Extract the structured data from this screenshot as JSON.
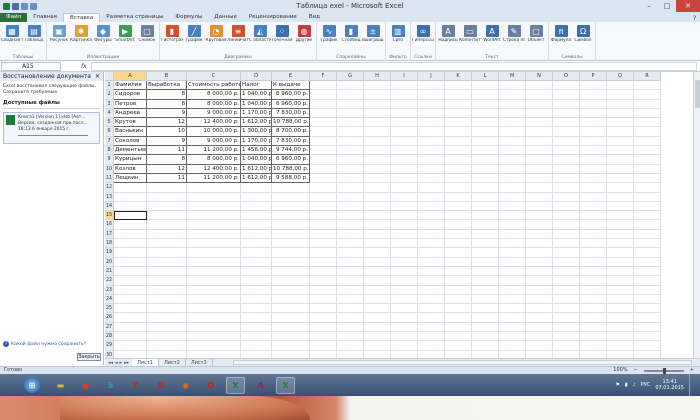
{
  "window": {
    "title": "Таблица exel  -  Microsoft Excel",
    "min": "–",
    "max": "□",
    "close": "✕"
  },
  "tabs": [
    "Файл",
    "Главная",
    "Вставка",
    "Разметка страницы",
    "Формулы",
    "Данные",
    "Рецензирование",
    "Вид"
  ],
  "active_tab": "Вставка",
  "ribbon_groups": [
    {
      "label": "Таблицы",
      "buttons": [
        {
          "label": "Сводная таблица",
          "icon": "pivot-table-icon",
          "color": "#4a7fc1",
          "glyph": "▦"
        },
        {
          "label": "Таблица",
          "icon": "table-icon",
          "color": "#4a7fc1",
          "glyph": "▤"
        }
      ]
    },
    {
      "label": "Иллюстрации",
      "buttons": [
        {
          "label": "Рисунок",
          "icon": "picture-icon",
          "color": "#6aa0d0",
          "glyph": "▣"
        },
        {
          "label": "Картинка",
          "icon": "clipart-icon",
          "color": "#e0a030",
          "glyph": "✱"
        },
        {
          "label": "Фигуры",
          "icon": "shapes-icon",
          "color": "#5a8fd0",
          "glyph": "◆"
        },
        {
          "label": "SmartArt",
          "icon": "smartart-icon",
          "color": "#3e9a50",
          "glyph": "▶"
        },
        {
          "label": "Снимок",
          "icon": "screenshot-icon",
          "color": "#6a7fa0",
          "glyph": "▢"
        }
      ]
    },
    {
      "label": "Диаграммы",
      "buttons": [
        {
          "label": "Гистограмма",
          "icon": "column-chart-icon",
          "color": "#d05030",
          "glyph": "▮"
        },
        {
          "label": "График",
          "icon": "line-chart-icon",
          "color": "#4a7fc1",
          "glyph": "╱"
        },
        {
          "label": "Круговая",
          "icon": "pie-chart-icon",
          "color": "#e09030",
          "glyph": "◔"
        },
        {
          "label": "Линейчатая",
          "icon": "bar-chart-icon",
          "color": "#d05030",
          "glyph": "≡"
        },
        {
          "label": "С областями",
          "icon": "area-chart-icon",
          "color": "#4a7fc1",
          "glyph": "◭"
        },
        {
          "label": "Точечная",
          "icon": "scatter-chart-icon",
          "color": "#3e6fb0",
          "glyph": "⁘"
        },
        {
          "label": "Другие",
          "icon": "other-charts-icon",
          "color": "#c04040",
          "glyph": "◍"
        }
      ]
    },
    {
      "label": "Спарклайны",
      "buttons": [
        {
          "label": "График",
          "icon": "sparkline-line-icon",
          "color": "#4a7fc1",
          "glyph": "∿"
        },
        {
          "label": "Столбец",
          "icon": "sparkline-column-icon",
          "color": "#4a7fc1",
          "glyph": "▮"
        },
        {
          "label": "Выигрыш / проигрыш",
          "icon": "sparkline-winloss-icon",
          "color": "#4a7fc1",
          "glyph": "±"
        }
      ]
    },
    {
      "label": "Фильтр",
      "buttons": [
        {
          "label": "Срез",
          "icon": "slicer-icon",
          "color": "#4a7fc1",
          "glyph": "▥"
        }
      ]
    },
    {
      "label": "Ссылки",
      "buttons": [
        {
          "label": "Гиперссылка",
          "icon": "hyperlink-icon",
          "color": "#3e6fb0",
          "glyph": "∞"
        }
      ]
    },
    {
      "label": "Текст",
      "buttons": [
        {
          "label": "Надпись",
          "icon": "textbox-icon",
          "color": "#6a7fa0",
          "glyph": "A"
        },
        {
          "label": "Колонтитулы",
          "icon": "header-footer-icon",
          "color": "#6a7fa0",
          "glyph": "▭"
        },
        {
          "label": "WordArt",
          "icon": "wordart-icon",
          "color": "#3e6fb0",
          "glyph": "A"
        },
        {
          "label": "Строка подписи",
          "icon": "signature-line-icon",
          "color": "#6a7fa0",
          "glyph": "✎"
        },
        {
          "label": "Объект",
          "icon": "object-icon",
          "color": "#6a7fa0",
          "glyph": "▢"
        }
      ]
    },
    {
      "label": "Символы",
      "buttons": [
        {
          "label": "Формула",
          "icon": "equation-icon",
          "color": "#3e6fb0",
          "glyph": "π"
        },
        {
          "label": "Символ",
          "icon": "symbol-icon",
          "color": "#3e6fb0",
          "glyph": "Ω"
        }
      ]
    }
  ],
  "formula_bar": {
    "namebox": "A15",
    "fx": "fx",
    "value": ""
  },
  "recovery": {
    "title": "Восстановление документа",
    "description": "Excel восстановил следующие файлы. Сохраните требуемые.",
    "available_label": "Доступные файлы",
    "file": {
      "line1": "Книга1 [Version 1].xlsb [Авт...",
      "line2": "Версия, созданная при посл...",
      "line3": "18:13 6 января 2015 г."
    },
    "help_link": "Какой файл нужно сохранить?",
    "close_button": "Закрыть"
  },
  "grid": {
    "columns": [
      "A",
      "B",
      "C",
      "D",
      "E",
      "F",
      "G",
      "H",
      "I",
      "J",
      "K",
      "L",
      "M",
      "N",
      "O",
      "P",
      "Q",
      "R"
    ],
    "header": [
      "Фамилия",
      "Выработка",
      "Стоимость работы",
      "Налог",
      "К выдаче"
    ],
    "rows": [
      [
        "Сидоров",
        "8",
        "8 000,00 р.",
        "1 040,00 р.",
        "6 960,00 р."
      ],
      [
        "Петров",
        "8",
        "8 000,00 р.",
        "1 040,00 р.",
        "6 960,00 р."
      ],
      [
        "Андреев",
        "9",
        "9 000,00 р.",
        "1 170,00 р.",
        "7 830,00 р."
      ],
      [
        "Крутов",
        "12",
        "12 400,00 р.",
        "1 612,00 р.",
        "10 788,00 р."
      ],
      [
        "Васнькин",
        "10",
        "10 000,00 р.",
        "1 300,00 р.",
        "8 700,00 р."
      ],
      [
        "Соколов",
        "9",
        "9 000,00 р.",
        "1 170,00 р.",
        "7 830,00 р."
      ],
      [
        "Дементьев",
        "11",
        "11 200,00 р.",
        "1 456,00 р.",
        "9 744,00 р."
      ],
      [
        "Курицын",
        "8",
        "8 000,00 р.",
        "1 040,00 р.",
        "6 960,00 р."
      ],
      [
        "Козлов",
        "12",
        "12 400,00 р.",
        "1 612,00 р.",
        "10 788,00 р."
      ],
      [
        "Лещкин",
        "11",
        "11 200,00 р.",
        "1 612,00 р.",
        "9 588,00 р."
      ]
    ],
    "row_count": 30,
    "active_row": 15,
    "active_col": "A"
  },
  "sheets": [
    "Лист1",
    "Лист2",
    "Лист3"
  ],
  "active_sheet": "Лист1",
  "status": {
    "ready": "Готово",
    "zoom": "100%"
  },
  "taskbar": {
    "apps": [
      {
        "name": "explorer-app",
        "glyph": "▬",
        "color": "#e0b040"
      },
      {
        "name": "chrome-app",
        "glyph": "●",
        "color": "#d04030"
      },
      {
        "name": "skype-app",
        "glyph": "S",
        "color": "#2a9ad8"
      },
      {
        "name": "yandex-app",
        "glyph": "Y",
        "color": "#d02020"
      },
      {
        "name": "yandex-browser-app",
        "glyph": "Я",
        "color": "#d02020"
      },
      {
        "name": "firefox-app",
        "glyph": "◉",
        "color": "#e07020"
      },
      {
        "name": "opera-app",
        "glyph": "O",
        "color": "#c02020"
      },
      {
        "name": "excel-task-app",
        "glyph": "X",
        "color": "#1f7a3f"
      },
      {
        "name": "access-app",
        "glyph": "A",
        "color": "#a02040"
      },
      {
        "name": "excel-app-2",
        "glyph": "X",
        "color": "#1f7a3f"
      }
    ],
    "lang": "РУС",
    "time": "13:41",
    "date": "07.01.2015"
  }
}
